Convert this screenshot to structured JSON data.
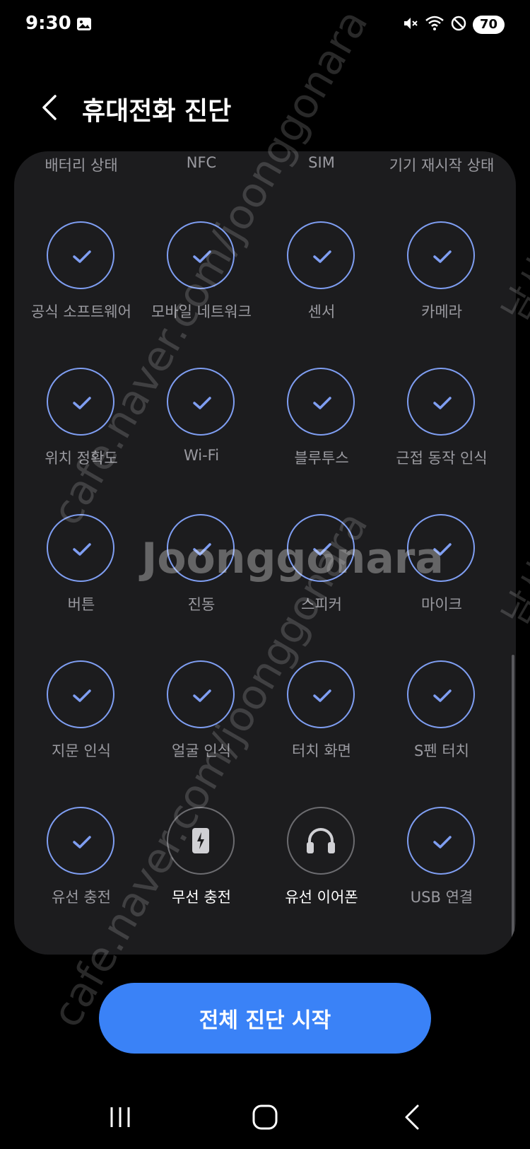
{
  "status_bar": {
    "time": "9:30",
    "battery": "70",
    "icons": [
      "gallery-icon",
      "mute-icon",
      "wifi-icon",
      "do-not-disturb-icon"
    ]
  },
  "header": {
    "title": "휴대전화 진단"
  },
  "diagnostics": {
    "items": [
      {
        "label": "배터리 상태",
        "status": "passed"
      },
      {
        "label": "NFC",
        "status": "passed"
      },
      {
        "label": "SIM",
        "status": "passed"
      },
      {
        "label": "기기 재시작 상태",
        "status": "passed"
      },
      {
        "label": "공식 소프트웨어",
        "status": "passed"
      },
      {
        "label": "모바일 네트워크",
        "status": "passed"
      },
      {
        "label": "센서",
        "status": "passed"
      },
      {
        "label": "카메라",
        "status": "passed"
      },
      {
        "label": "위치 정확도",
        "status": "passed"
      },
      {
        "label": "Wi-Fi",
        "status": "passed"
      },
      {
        "label": "블루투스",
        "status": "passed"
      },
      {
        "label": "근접 동작 인식",
        "status": "passed"
      },
      {
        "label": "버튼",
        "status": "passed"
      },
      {
        "label": "진동",
        "status": "passed"
      },
      {
        "label": "스피커",
        "status": "passed"
      },
      {
        "label": "마이크",
        "status": "passed"
      },
      {
        "label": "지문 인식",
        "status": "passed"
      },
      {
        "label": "얼굴 인식",
        "status": "passed"
      },
      {
        "label": "터치 화면",
        "status": "passed"
      },
      {
        "label": "S펜 터치",
        "status": "passed"
      },
      {
        "label": "유선 충전",
        "status": "passed"
      },
      {
        "label": "무선 충전",
        "status": "not_tested",
        "icon": "wireless-charging-icon"
      },
      {
        "label": "유선 이어폰",
        "status": "not_tested",
        "icon": "headphones-icon"
      },
      {
        "label": "USB 연결",
        "status": "passed"
      }
    ]
  },
  "action": {
    "start_all_label": "전체 진단 시작"
  },
  "watermark": {
    "brand": "Joonggonara",
    "url": "cafe.naver.com/joonggonara",
    "side_text": "남시"
  },
  "colors": {
    "accent": "#3a82f7",
    "check_ring": "#7f9ef2",
    "panel_bg": "#1c1c1e"
  }
}
